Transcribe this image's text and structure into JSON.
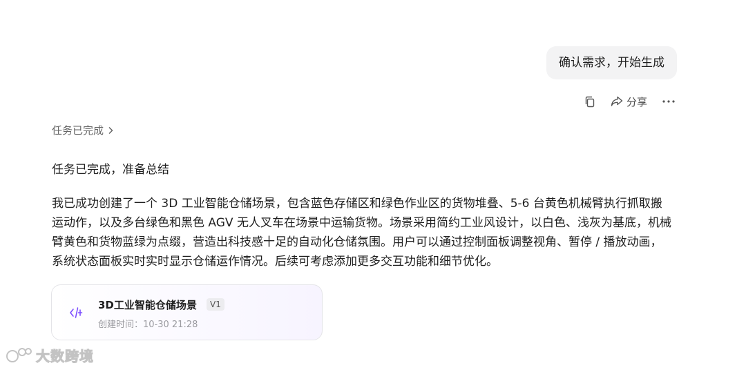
{
  "user_message": {
    "text": "确认需求，开始生成"
  },
  "message_actions": {
    "copy_icon": "copy-icon",
    "share_label": "分享",
    "share_icon": "share-icon",
    "more_icon": "more-icon"
  },
  "task": {
    "toggle_label": "任务已完成",
    "status_text": "任务已完成，准备总结"
  },
  "summary": {
    "text": "我已成功创建了一个 3D 工业智能仓储场景，包含蓝色存储区和绿色作业区的货物堆叠、5-6 台黄色机械臂执行抓取搬运动作，以及多台绿色和黑色 AGV 无人叉车在场景中运输货物。场景采用简约工业风设计，以白色、浅灰为基底，机械臂黄色和货物蓝绿为点缀，营造出科技感十足的自动化仓储氛围。用户可以通过控制面板调整视角、暂停 / 播放动画，系统状态面板实时实时显示仓储运作情况。后续可考虑添加更多交互功能和细节优化。"
  },
  "artifact": {
    "title": "3D工业智能仓储场景",
    "version": "V1",
    "created": "创建时间：10-30 21:28",
    "icon": "code-icon",
    "accent_color": "#7c4dff"
  },
  "watermark": {
    "text": "大数跨境"
  }
}
